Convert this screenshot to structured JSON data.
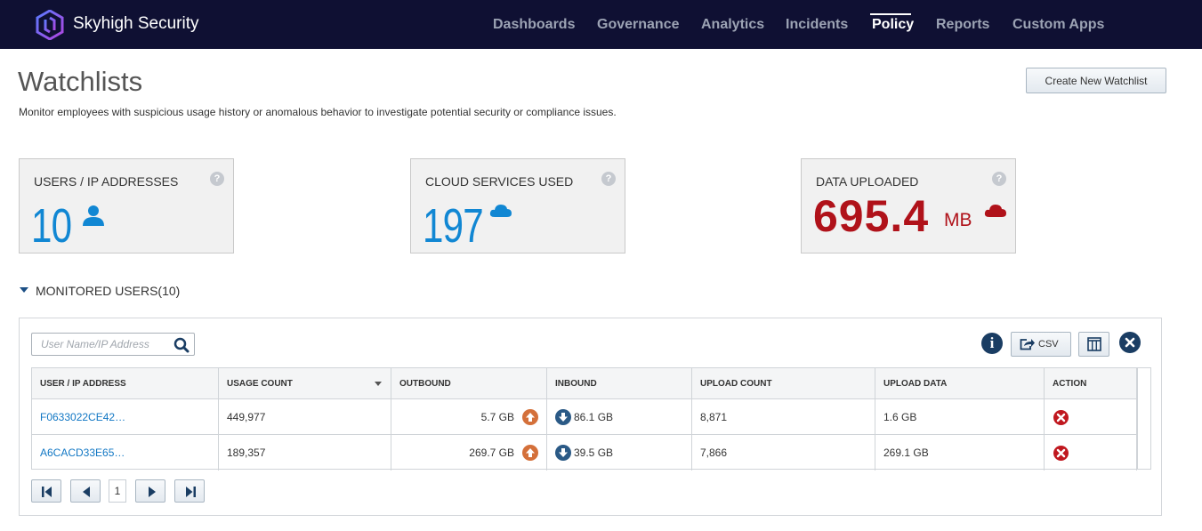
{
  "brand": {
    "name": "Skyhigh Security"
  },
  "nav": {
    "items": [
      {
        "label": "Dashboards",
        "active": false
      },
      {
        "label": "Governance",
        "active": false
      },
      {
        "label": "Analytics",
        "active": false
      },
      {
        "label": "Incidents",
        "active": false
      },
      {
        "label": "Policy",
        "active": true
      },
      {
        "label": "Reports",
        "active": false
      },
      {
        "label": "Custom Apps",
        "active": false
      }
    ]
  },
  "header": {
    "title": "Watchlists",
    "description": "Monitor employees with suspicious usage history or anomalous behavior to investigate potential security or compliance issues.",
    "create_button": "Create New Watchlist"
  },
  "stats": [
    {
      "label": "USERS / IP ADDRESSES",
      "value": "10",
      "icon": "user-icon",
      "color": "#1187d3"
    },
    {
      "label": "CLOUD SERVICES USED",
      "value": "197",
      "icon": "cloud-icon",
      "color": "#1187d3"
    },
    {
      "label": "DATA UPLOADED",
      "value": "695.4",
      "unit": "MB",
      "icon": "cloud-icon",
      "color": "#b0121a"
    }
  ],
  "section": {
    "title": "MONITORED USERS(10)",
    "expanded": true
  },
  "table": {
    "search_placeholder": "User Name/IP Address",
    "csv_label": "CSV",
    "columns": [
      "USER / IP ADDRESS",
      "USAGE COUNT",
      "OUTBOUND",
      "INBOUND",
      "UPLOAD COUNT",
      "UPLOAD DATA",
      "ACTION"
    ],
    "sorted_column": "USAGE COUNT",
    "rows": [
      {
        "user": "F0633022CE42…",
        "usage_count": "449,977",
        "outbound": "5.7 GB",
        "inbound": "86.1 GB",
        "upload_count": "8,871",
        "upload_data": "1.6 GB"
      },
      {
        "user": "A6CACD33E65…",
        "usage_count": "189,357",
        "outbound": "269.7 GB",
        "inbound": "39.5 GB",
        "upload_count": "7,866",
        "upload_data": "269.1 GB"
      }
    ]
  },
  "pager": {
    "current_page": "1"
  },
  "colors": {
    "topbar": "#0f1033",
    "accent_blue": "#1187d3",
    "accent_red": "#b0121a",
    "outbound_arrow": "#d4703a",
    "inbound_arrow": "#2b5a86"
  }
}
